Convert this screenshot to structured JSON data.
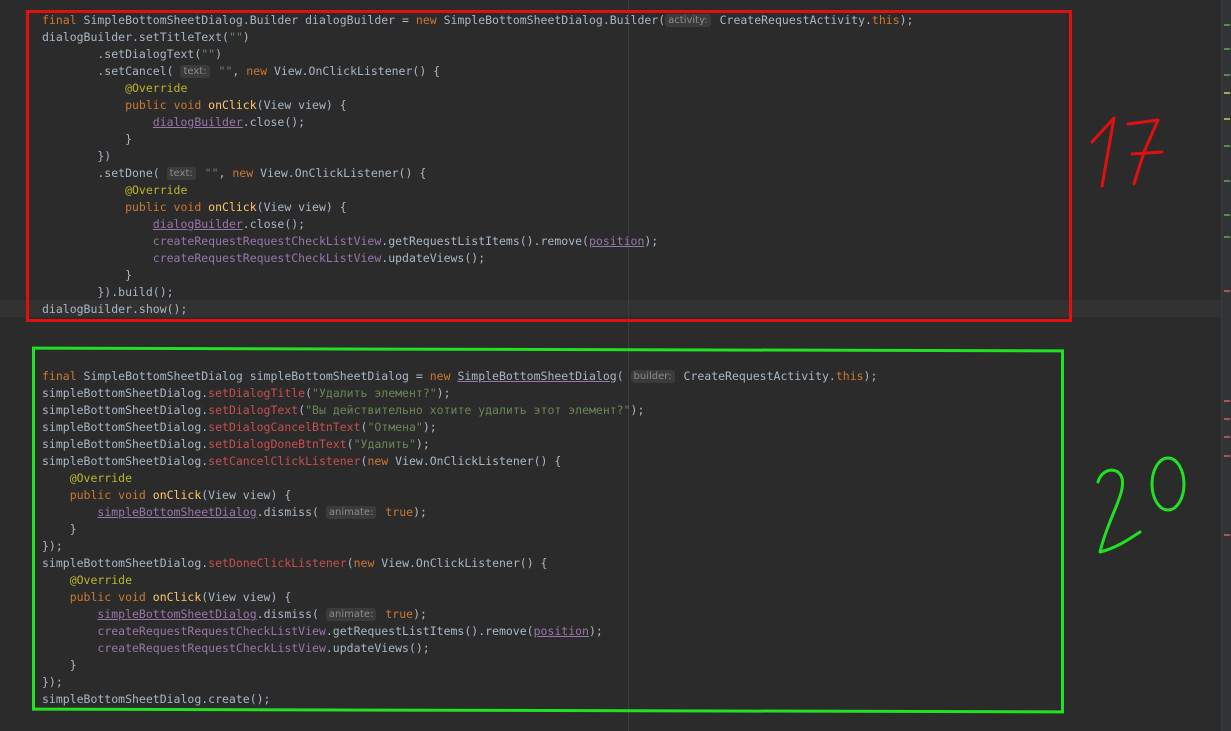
{
  "annotations": {
    "top_number": "17",
    "bottom_number": "20",
    "top_color": "#e01010",
    "bottom_color": "#22e022"
  },
  "code_top": [
    [
      [
        "kw",
        "final "
      ],
      [
        "dflt",
        "SimpleBottomSheetDialog.Builder dialogBuilder = "
      ],
      [
        "kw",
        "new "
      ],
      [
        "dflt",
        "SimpleBottomSheetDialog.Builder("
      ],
      [
        "hint",
        "activity:"
      ],
      [
        "dflt",
        " CreateRequestActivity."
      ],
      [
        "kw",
        "this"
      ],
      [
        "dflt",
        ");"
      ]
    ],
    [
      [
        "dflt",
        "dialogBuilder.setTitleText("
      ],
      [
        "str",
        "\"\""
      ],
      [
        "dflt",
        ")"
      ]
    ],
    [
      [
        "dflt",
        "        .setDialogText("
      ],
      [
        "str",
        "\"\""
      ],
      [
        "dflt",
        ")"
      ]
    ],
    [
      [
        "dflt",
        "        .setCancel( "
      ],
      [
        "hint",
        "text:"
      ],
      [
        "str",
        " \"\""
      ],
      [
        "dflt",
        ", "
      ],
      [
        "kw",
        "new "
      ],
      [
        "dflt",
        "View.OnClickListener() {"
      ]
    ],
    [
      [
        "ann",
        "            @Override"
      ]
    ],
    [
      [
        "kw",
        "            public void "
      ],
      [
        "fn",
        "onClick"
      ],
      [
        "dflt",
        "(View view) {"
      ]
    ],
    [
      [
        "dflt",
        "                "
      ],
      [
        "fldu",
        "dialogBuilder"
      ],
      [
        "dflt",
        ".close();"
      ]
    ],
    [
      [
        "dflt",
        "            }"
      ]
    ],
    [
      [
        "dflt",
        "        })"
      ]
    ],
    [
      [
        "dflt",
        "        .setDone( "
      ],
      [
        "hint",
        "text:"
      ],
      [
        "str",
        " \"\""
      ],
      [
        "dflt",
        ", "
      ],
      [
        "kw",
        "new "
      ],
      [
        "dflt",
        "View.OnClickListener() {"
      ]
    ],
    [
      [
        "ann",
        "            @Override"
      ]
    ],
    [
      [
        "kw",
        "            public void "
      ],
      [
        "fn",
        "onClick"
      ],
      [
        "dflt",
        "(View view) {"
      ]
    ],
    [
      [
        "dflt",
        "                "
      ],
      [
        "fldu",
        "dialogBuilder"
      ],
      [
        "dflt",
        ".close();"
      ]
    ],
    [
      [
        "dflt",
        "                "
      ],
      [
        "fld",
        "createRequestRequestCheckListView"
      ],
      [
        "dflt",
        ".getRequestListItems().remove("
      ],
      [
        "fldu",
        "position"
      ],
      [
        "dflt",
        ");"
      ]
    ],
    [
      [
        "dflt",
        "                "
      ],
      [
        "fld",
        "createRequestRequestCheckListView"
      ],
      [
        "dflt",
        ".updateViews();"
      ]
    ],
    [
      [
        "dflt",
        "            }"
      ]
    ],
    [
      [
        "dflt",
        "        }).build();"
      ]
    ],
    [
      [
        "dflt",
        "dialogBuilder.show();"
      ]
    ]
  ],
  "code_bottom": [
    [
      [
        "kw",
        "final "
      ],
      [
        "dflt",
        "SimpleBottomSheetDialog simpleBottomSheetDialog = "
      ],
      [
        "kw",
        "new "
      ],
      [
        "dfltu",
        "SimpleBottomSheetDialog"
      ],
      [
        "dflt",
        "( "
      ],
      [
        "hint",
        "builder:"
      ],
      [
        "dflt",
        " CreateRequestActivity."
      ],
      [
        "kw",
        "this"
      ],
      [
        "dflt",
        ");"
      ]
    ],
    [
      [
        "dflt",
        "simpleBottomSheetDialog."
      ],
      [
        "mth",
        "setDialogTitle"
      ],
      [
        "dflt",
        "("
      ],
      [
        "str",
        "\"Удалить элемент?\""
      ],
      [
        "dflt",
        ");"
      ]
    ],
    [
      [
        "dflt",
        "simpleBottomSheetDialog."
      ],
      [
        "mth",
        "setDialogText"
      ],
      [
        "dflt",
        "("
      ],
      [
        "str",
        "\"Вы действительно хотите удалить этот элемент?\""
      ],
      [
        "dflt",
        ");"
      ]
    ],
    [
      [
        "dflt",
        "simpleBottomSheetDialog."
      ],
      [
        "mth",
        "setDialogCancelBtnText"
      ],
      [
        "dflt",
        "("
      ],
      [
        "str",
        "\"Отмена\""
      ],
      [
        "dflt",
        ");"
      ]
    ],
    [
      [
        "dflt",
        "simpleBottomSheetDialog."
      ],
      [
        "mth",
        "setDialogDoneBtnText"
      ],
      [
        "dflt",
        "("
      ],
      [
        "str",
        "\"Удалить\""
      ],
      [
        "dflt",
        ");"
      ]
    ],
    [
      [
        "dflt",
        "simpleBottomSheetDialog."
      ],
      [
        "mth",
        "setCancelClickListener"
      ],
      [
        "dflt",
        "("
      ],
      [
        "kw",
        "new "
      ],
      [
        "dflt",
        "View.OnClickListener() {"
      ]
    ],
    [
      [
        "ann",
        "    @Override"
      ]
    ],
    [
      [
        "kw",
        "    public void "
      ],
      [
        "fn",
        "onClick"
      ],
      [
        "dflt",
        "(View view) {"
      ]
    ],
    [
      [
        "dflt",
        "        "
      ],
      [
        "fldu",
        "simpleBottomSheetDialog"
      ],
      [
        "dflt",
        ".dismiss( "
      ],
      [
        "hint",
        "animate:"
      ],
      [
        "kw",
        " true"
      ],
      [
        "dflt",
        ");"
      ]
    ],
    [
      [
        "dflt",
        "    }"
      ]
    ],
    [
      [
        "dflt",
        "});"
      ]
    ],
    [
      [
        "dflt",
        "simpleBottomSheetDialog."
      ],
      [
        "mth",
        "setDoneClickListener"
      ],
      [
        "dflt",
        "("
      ],
      [
        "kw",
        "new "
      ],
      [
        "dflt",
        "View.OnClickListener() {"
      ]
    ],
    [
      [
        "ann",
        "    @Override"
      ]
    ],
    [
      [
        "kw",
        "    public void "
      ],
      [
        "fn",
        "onClick"
      ],
      [
        "dflt",
        "(View view) {"
      ]
    ],
    [
      [
        "dflt",
        "        "
      ],
      [
        "fldu",
        "simpleBottomSheetDialog"
      ],
      [
        "dflt",
        ".dismiss( "
      ],
      [
        "hint",
        "animate:"
      ],
      [
        "kw",
        " true"
      ],
      [
        "dflt",
        ");"
      ]
    ],
    [
      [
        "dflt",
        "        "
      ],
      [
        "fld",
        "createRequestRequestCheckListView"
      ],
      [
        "dflt",
        ".getRequestListItems().remove("
      ],
      [
        "fldu",
        "position"
      ],
      [
        "dflt",
        ");"
      ]
    ],
    [
      [
        "dflt",
        "        "
      ],
      [
        "fld",
        "createRequestRequestCheckListView"
      ],
      [
        "dflt",
        ".updateViews();"
      ]
    ],
    [
      [
        "dflt",
        "    }"
      ]
    ],
    [
      [
        "dflt",
        "});"
      ]
    ],
    [
      [
        "dflt",
        "simpleBottomSheetDialog.create();"
      ]
    ]
  ]
}
